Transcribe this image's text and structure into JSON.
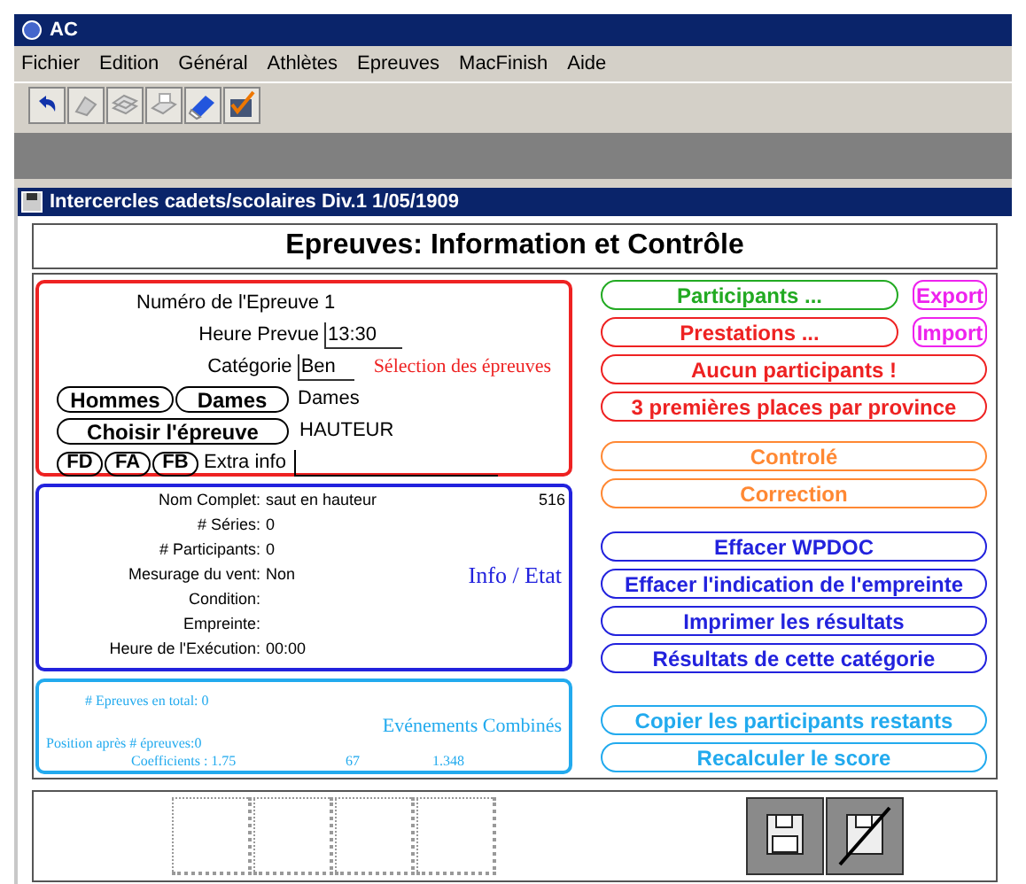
{
  "app": {
    "title": "AC",
    "menu": [
      "Fichier",
      "Edition",
      "Général",
      "Athlètes",
      "Epreuves",
      "MacFinish",
      "Aide"
    ]
  },
  "document": {
    "title": "Intercercles cadets/scolaires Div.1 1/05/1909",
    "heading": "Epreuves: Information et Contrôle"
  },
  "selection": {
    "caption": "Sélection des épreuves",
    "numero_label": "Numéro de l'Epreuve",
    "numero": "1",
    "heure_label": "Heure Prevue",
    "heure": "13:30",
    "categorie_label": "Catégorie",
    "categorie": "Ben",
    "gender_buttons": [
      "Hommes",
      "Dames"
    ],
    "gender": "Dames",
    "choose_button": "Choisir l'épreuve",
    "event": "HAUTEUR",
    "small_buttons": [
      "FD",
      "FA",
      "FB"
    ],
    "extra_label": "Extra info"
  },
  "info": {
    "caption": "Info / Etat",
    "id": "516",
    "rows": [
      {
        "label": "Nom Complet:",
        "value": "saut en hauteur"
      },
      {
        "label": "# Séries:",
        "value": "0"
      },
      {
        "label": "# Participants:",
        "value": "0"
      },
      {
        "label": "Mesurage du vent:",
        "value": "Non"
      },
      {
        "label": "Condition:"
      },
      {
        "label": "Empreinte:"
      },
      {
        "label": "Heure de l'Exécution:",
        "value": "00:00"
      }
    ]
  },
  "combined": {
    "caption": "Evénements Combinés",
    "total": "# Epreuves en total: 0",
    "position": "Position après # épreuves:0",
    "coefficients": [
      "Coefficients : 1.75",
      "67",
      "1.348"
    ]
  },
  "button_groups": [
    [
      {
        "label": "Participants ...",
        "color": "#22aa22",
        "side": {
          "label": "Export",
          "color": "#ee22ee"
        }
      },
      {
        "label": "Prestations ...",
        "color": "#ee2222",
        "side": {
          "label": "Import",
          "color": "#ee22ee"
        }
      },
      {
        "label": "Aucun participants !",
        "color": "#ee2222"
      },
      {
        "label": "3 premières places par province",
        "color": "#ee2222"
      }
    ],
    [
      {
        "label": "Controlé",
        "color": "#ff8833"
      },
      {
        "label": "Correction",
        "color": "#ff8833"
      }
    ],
    [
      {
        "label": "Effacer WPDOC",
        "color": "#2222dd"
      },
      {
        "label": "Effacer l'indication de l'empreinte",
        "color": "#2222dd"
      },
      {
        "label": "Imprimer les résultats",
        "color": "#2222dd"
      },
      {
        "label": "Résultats de cette catégorie",
        "color": "#2222dd"
      }
    ],
    [
      {
        "label": "Copier les participants restants",
        "color": "#22aaee"
      },
      {
        "label": "Recalculer le score",
        "color": "#22aaee"
      }
    ]
  ]
}
